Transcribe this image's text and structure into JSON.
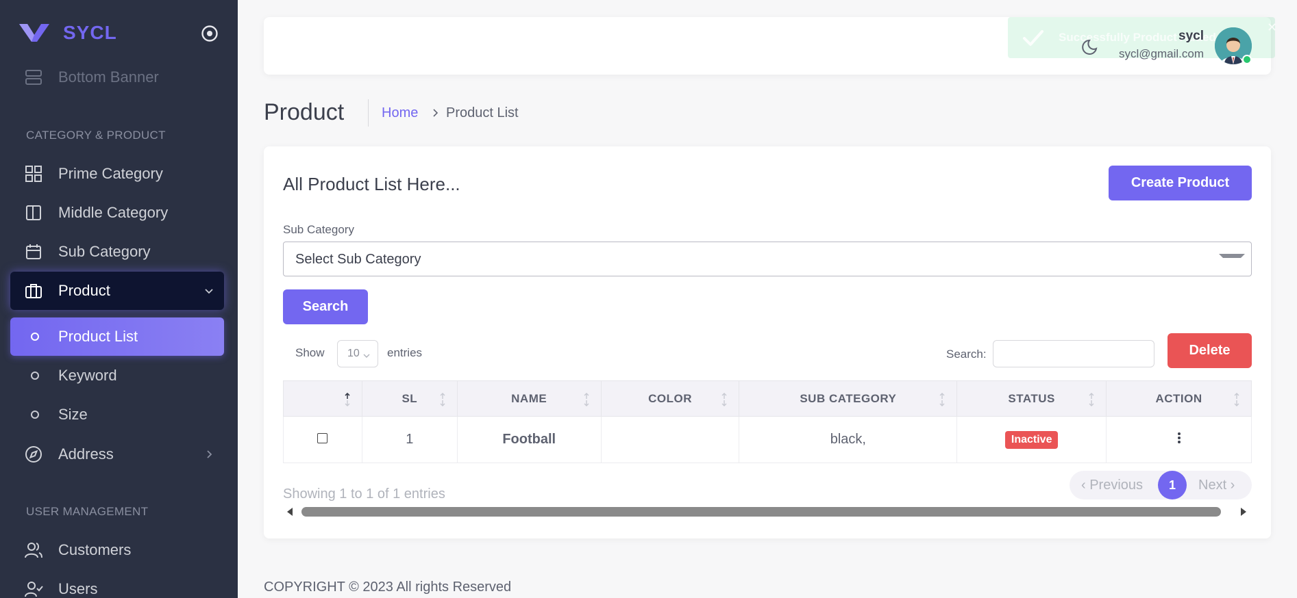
{
  "brand": {
    "name": "SYCL"
  },
  "sidebar": {
    "faded_item": "Bottom Banner",
    "sections": [
      "CATEGORY & PRODUCT",
      "USER MANAGEMENT"
    ],
    "items": [
      {
        "label": "Prime Category",
        "icon": "grid-icon"
      },
      {
        "label": "Middle Category",
        "icon": "layout-icon"
      },
      {
        "label": "Sub Category",
        "icon": "calendar-icon"
      },
      {
        "label": "Product",
        "icon": "briefcase-icon",
        "state": "expanded"
      },
      {
        "label": "Product List",
        "icon": "circle-icon",
        "state": "active"
      },
      {
        "label": "Keyword",
        "icon": "circle-icon"
      },
      {
        "label": "Size",
        "icon": "circle-icon"
      },
      {
        "label": "Address",
        "icon": "compass-icon"
      },
      {
        "label": "Customers",
        "icon": "users-icon"
      },
      {
        "label": "Users",
        "icon": "user-check-icon"
      }
    ]
  },
  "header": {
    "user_name": "sycl",
    "user_email": "sycl@gmail.com",
    "toast": "Successfully Product Added"
  },
  "breadcrumb": {
    "title": "Product",
    "home": "Home",
    "current": "Product List"
  },
  "card": {
    "title": "All Product List Here...",
    "create_button": "Create Product",
    "sub_category_label": "Sub Category",
    "sub_category_placeholder": "Select Sub Category",
    "search_button": "Search",
    "show_label": "Show",
    "show_value": "10",
    "entries_label": "entries",
    "search_label": "Search:",
    "delete_button": "Delete"
  },
  "table": {
    "columns": [
      "",
      "SL",
      "NAME",
      "COLOR",
      "SUB CATEGORY",
      "STATUS",
      "ACTION"
    ],
    "rows": [
      {
        "sl": "1",
        "name": "Football",
        "color": "",
        "sub_category": "black,",
        "status": "Inactive"
      }
    ]
  },
  "footer_info": {
    "showing": "Showing 1 to 1 of 1 entries",
    "previous": "Previous",
    "page": "1",
    "next": "Next"
  },
  "copyright": "COPYRIGHT © 2023 All rights Reserved",
  "colors": {
    "accent": "#7367f0",
    "danger": "#ea5455",
    "sidebar_bg": "#2b3143",
    "success": "#28c76f"
  }
}
